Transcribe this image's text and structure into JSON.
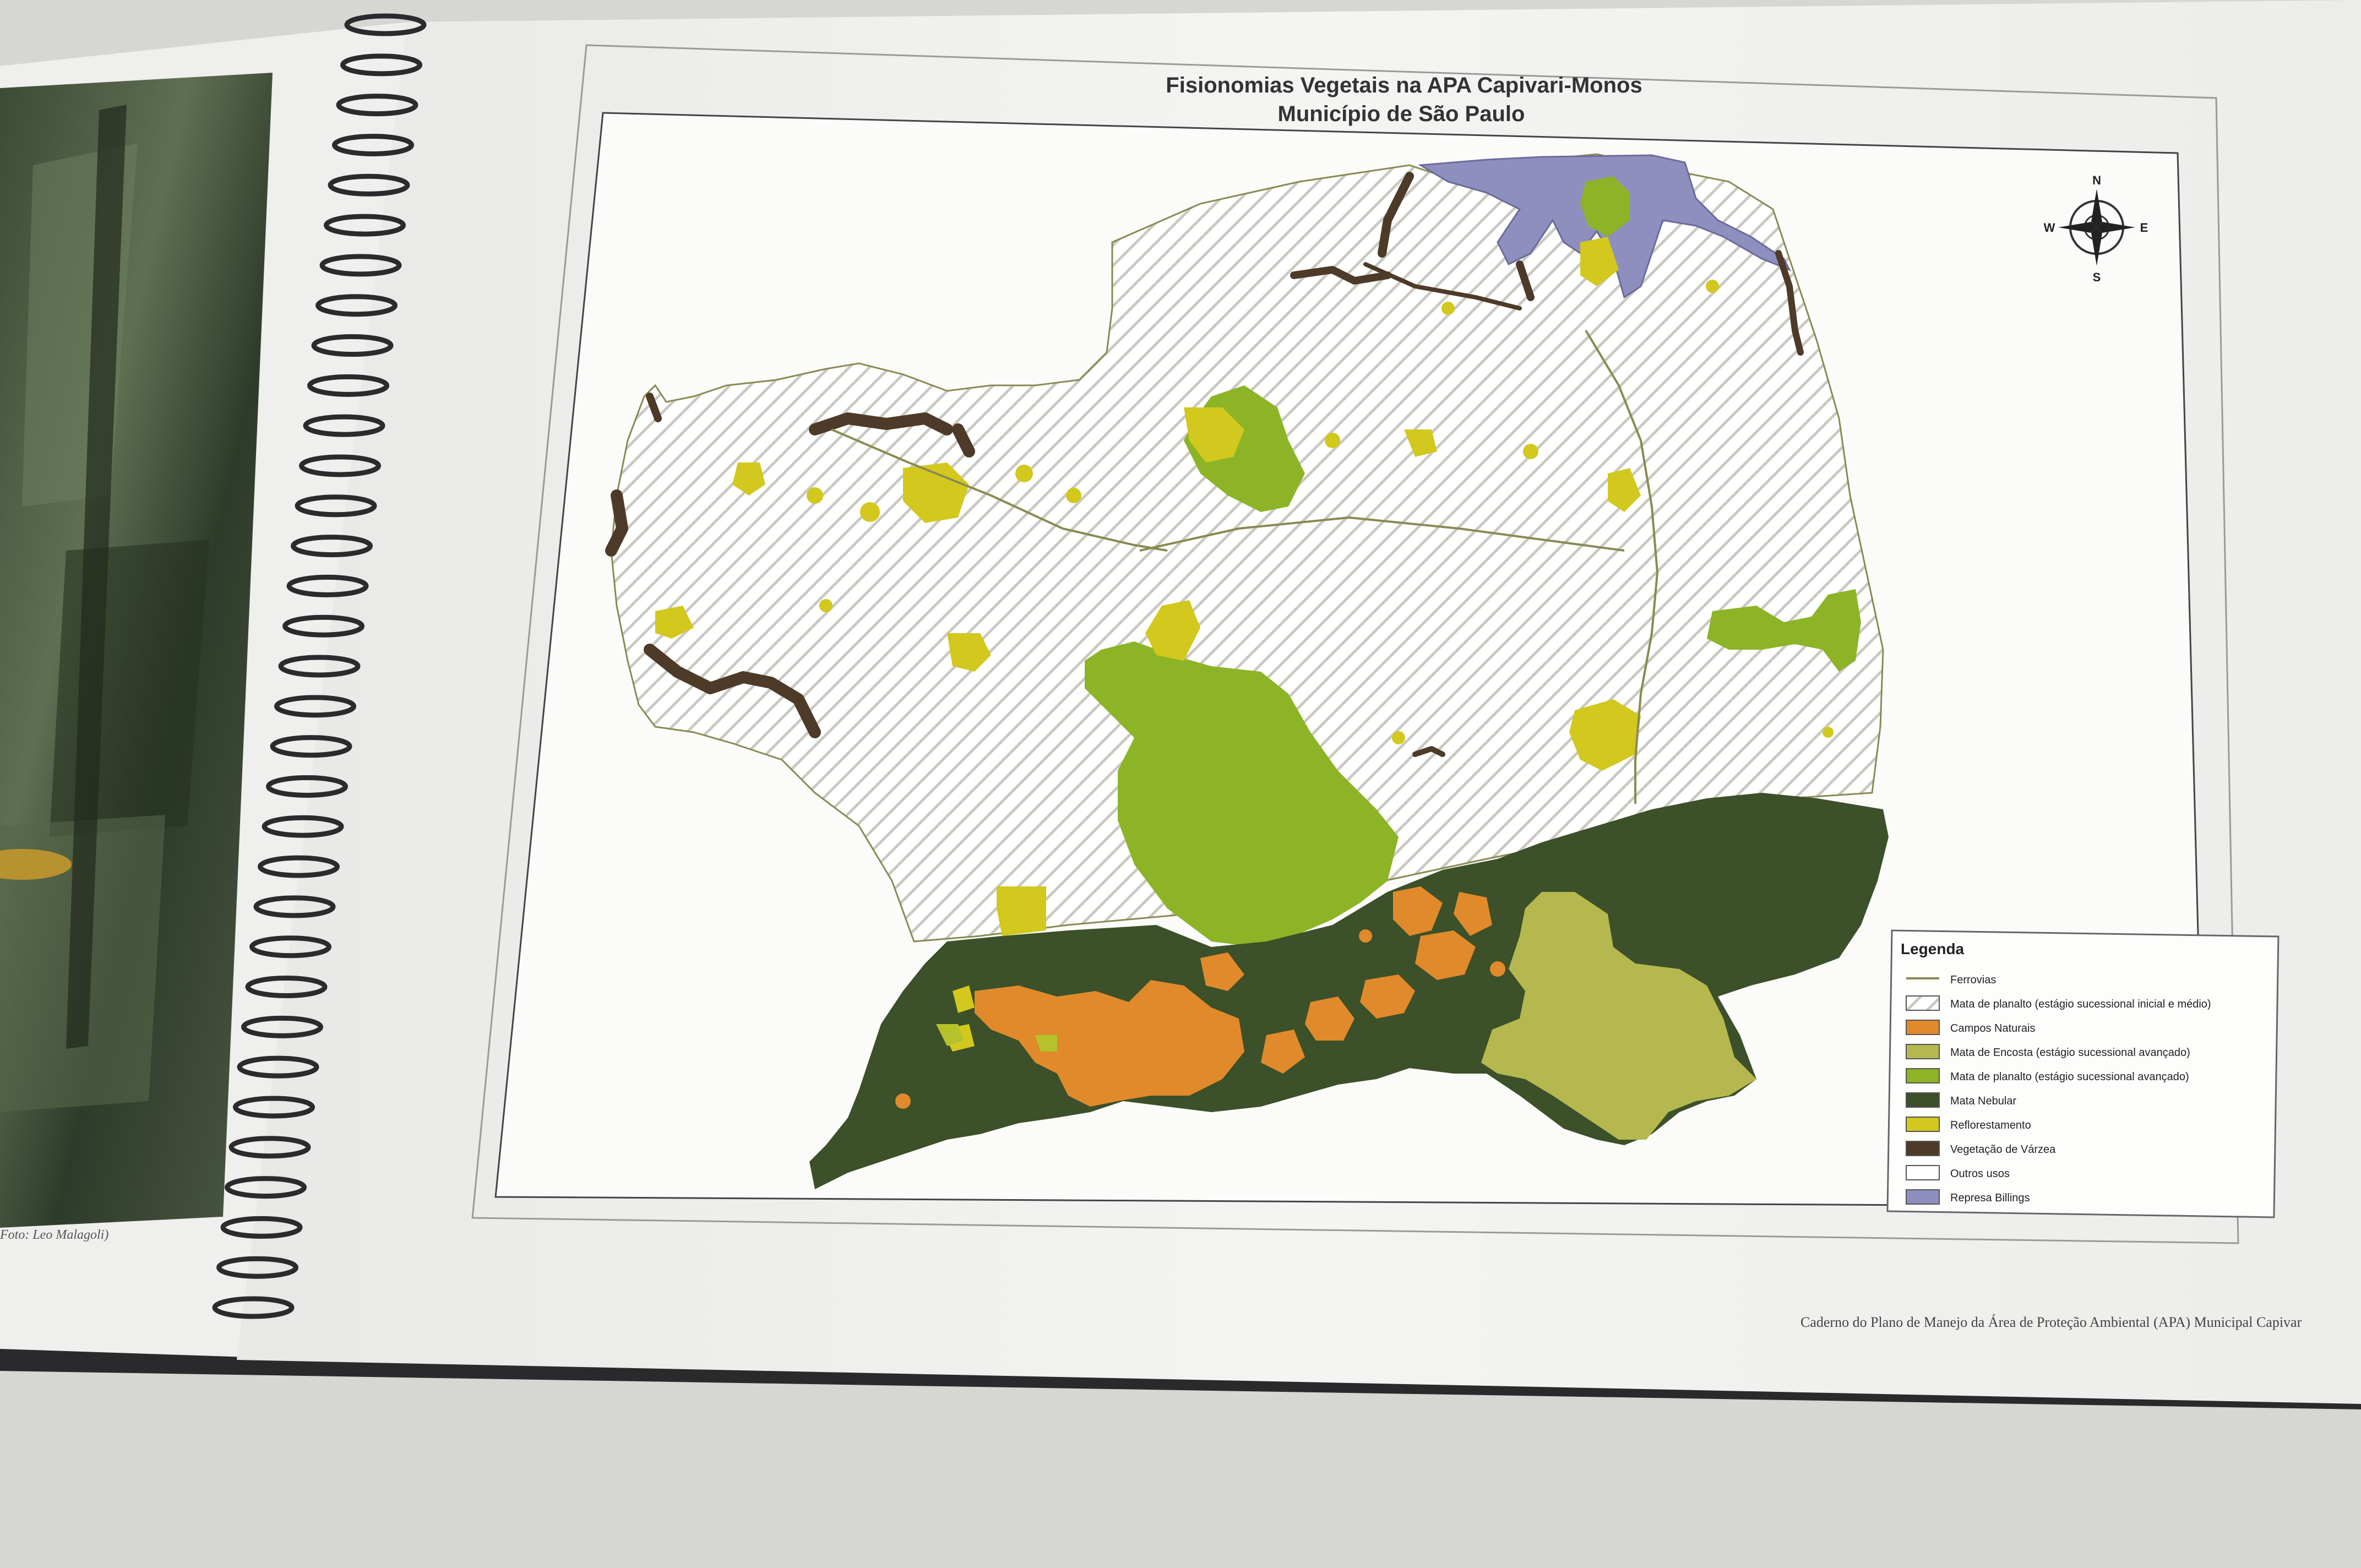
{
  "photo": {
    "caption": "Foto: Leo Malagoli)"
  },
  "map": {
    "title_line1": "Fisionomias Vegetais na APA Capivari-Monos",
    "title_line2": "Município de São Paulo",
    "compass": {
      "n": "N",
      "s": "S",
      "e": "E",
      "w": "W"
    },
    "legend": {
      "title": "Legenda",
      "items": [
        {
          "label": "Ferrovias",
          "symbol": "line",
          "color": "#8a8a52"
        },
        {
          "label": "Mata de planalto (estágio sucessional inicial e médio)",
          "symbol": "hatch",
          "color": "#c8c8c0"
        },
        {
          "label": "Campos Naturais",
          "symbol": "fill",
          "color": "#e08a2c"
        },
        {
          "label": "Mata de Encosta (estágio sucessional avançado)",
          "symbol": "fill",
          "color": "#b5b84e"
        },
        {
          "label": "Mata de planalto (estágio sucessional avançado)",
          "symbol": "fill",
          "color": "#8cb426"
        },
        {
          "label": "Mata Nebular",
          "symbol": "fill",
          "color": "#3c5029"
        },
        {
          "label": "Reflorestamento",
          "symbol": "fill",
          "color": "#d2c81e"
        },
        {
          "label": "Vegetação de Várzea",
          "symbol": "fill",
          "color": "#4e3a28"
        },
        {
          "label": "Outros usos",
          "symbol": "fill",
          "color": "#ffffff"
        },
        {
          "label": "Represa Billings",
          "symbol": "fill",
          "color": "#8e8fbf"
        }
      ]
    }
  },
  "footer": {
    "text": "Caderno do Plano de Manejo da Área de Proteção Ambiental (APA) Municipal Capivar"
  }
}
